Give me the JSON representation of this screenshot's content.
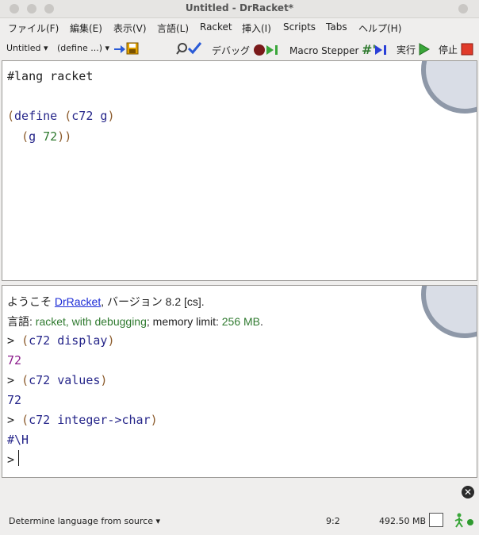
{
  "window": {
    "title": "Untitled - DrRacket*"
  },
  "menubar": [
    "ファイル(F)",
    "編集(E)",
    "表示(V)",
    "言語(L)",
    "Racket",
    "挿入(I)",
    "Scripts",
    "Tabs",
    "ヘルプ(H)"
  ],
  "toolbar": {
    "file_name": "Untitled",
    "define_menu": "(define ...)",
    "debug_label": "デバッグ",
    "macro_stepper_label": "Macro Stepper",
    "run_label": "実行",
    "stop_label": "停止"
  },
  "editor": {
    "line1": "#lang racket",
    "line2_open": "(",
    "line2_kw": "define",
    "line2_sp": " ",
    "line2_open2": "(",
    "line2_fn": "c72",
    "line2_arg": " g",
    "line2_close": ")",
    "line3_indent": "  ",
    "line3_open": "(",
    "line3_fn": "g",
    "line3_num": " 72",
    "line3_close": "))"
  },
  "repl": {
    "welcome_prefix": "ようこそ ",
    "welcome_link": "DrRacket",
    "welcome_suffix": ", バージョン 8.2 [cs].",
    "lang_label": "言語: ",
    "lang_value": "racket, with debugging",
    "mem_label": "; memory limit: ",
    "mem_value": "256 MB",
    "mem_end": ".",
    "prompt": ">",
    "entries": [
      {
        "input_open": "(",
        "input_body": "c72 display",
        "input_close": ")",
        "output": "72"
      },
      {
        "input_open": "(",
        "input_body": "c72 values",
        "input_close": ")",
        "output": "72"
      },
      {
        "input_open": "(",
        "input_body": "c72 integer->char",
        "input_close": ")",
        "output": "#\\H"
      }
    ]
  },
  "status": {
    "language_selector": "Determine language from source",
    "position": "9:2",
    "memory": "492.50 MB"
  },
  "colors": {
    "paren": "#8b5a2b",
    "keyword": "#26268a",
    "number": "#2f7a2f",
    "output": "#8b1b8b",
    "link": "#1c2bd6",
    "stop": "#e03a2a",
    "run": "#3aa63a"
  }
}
